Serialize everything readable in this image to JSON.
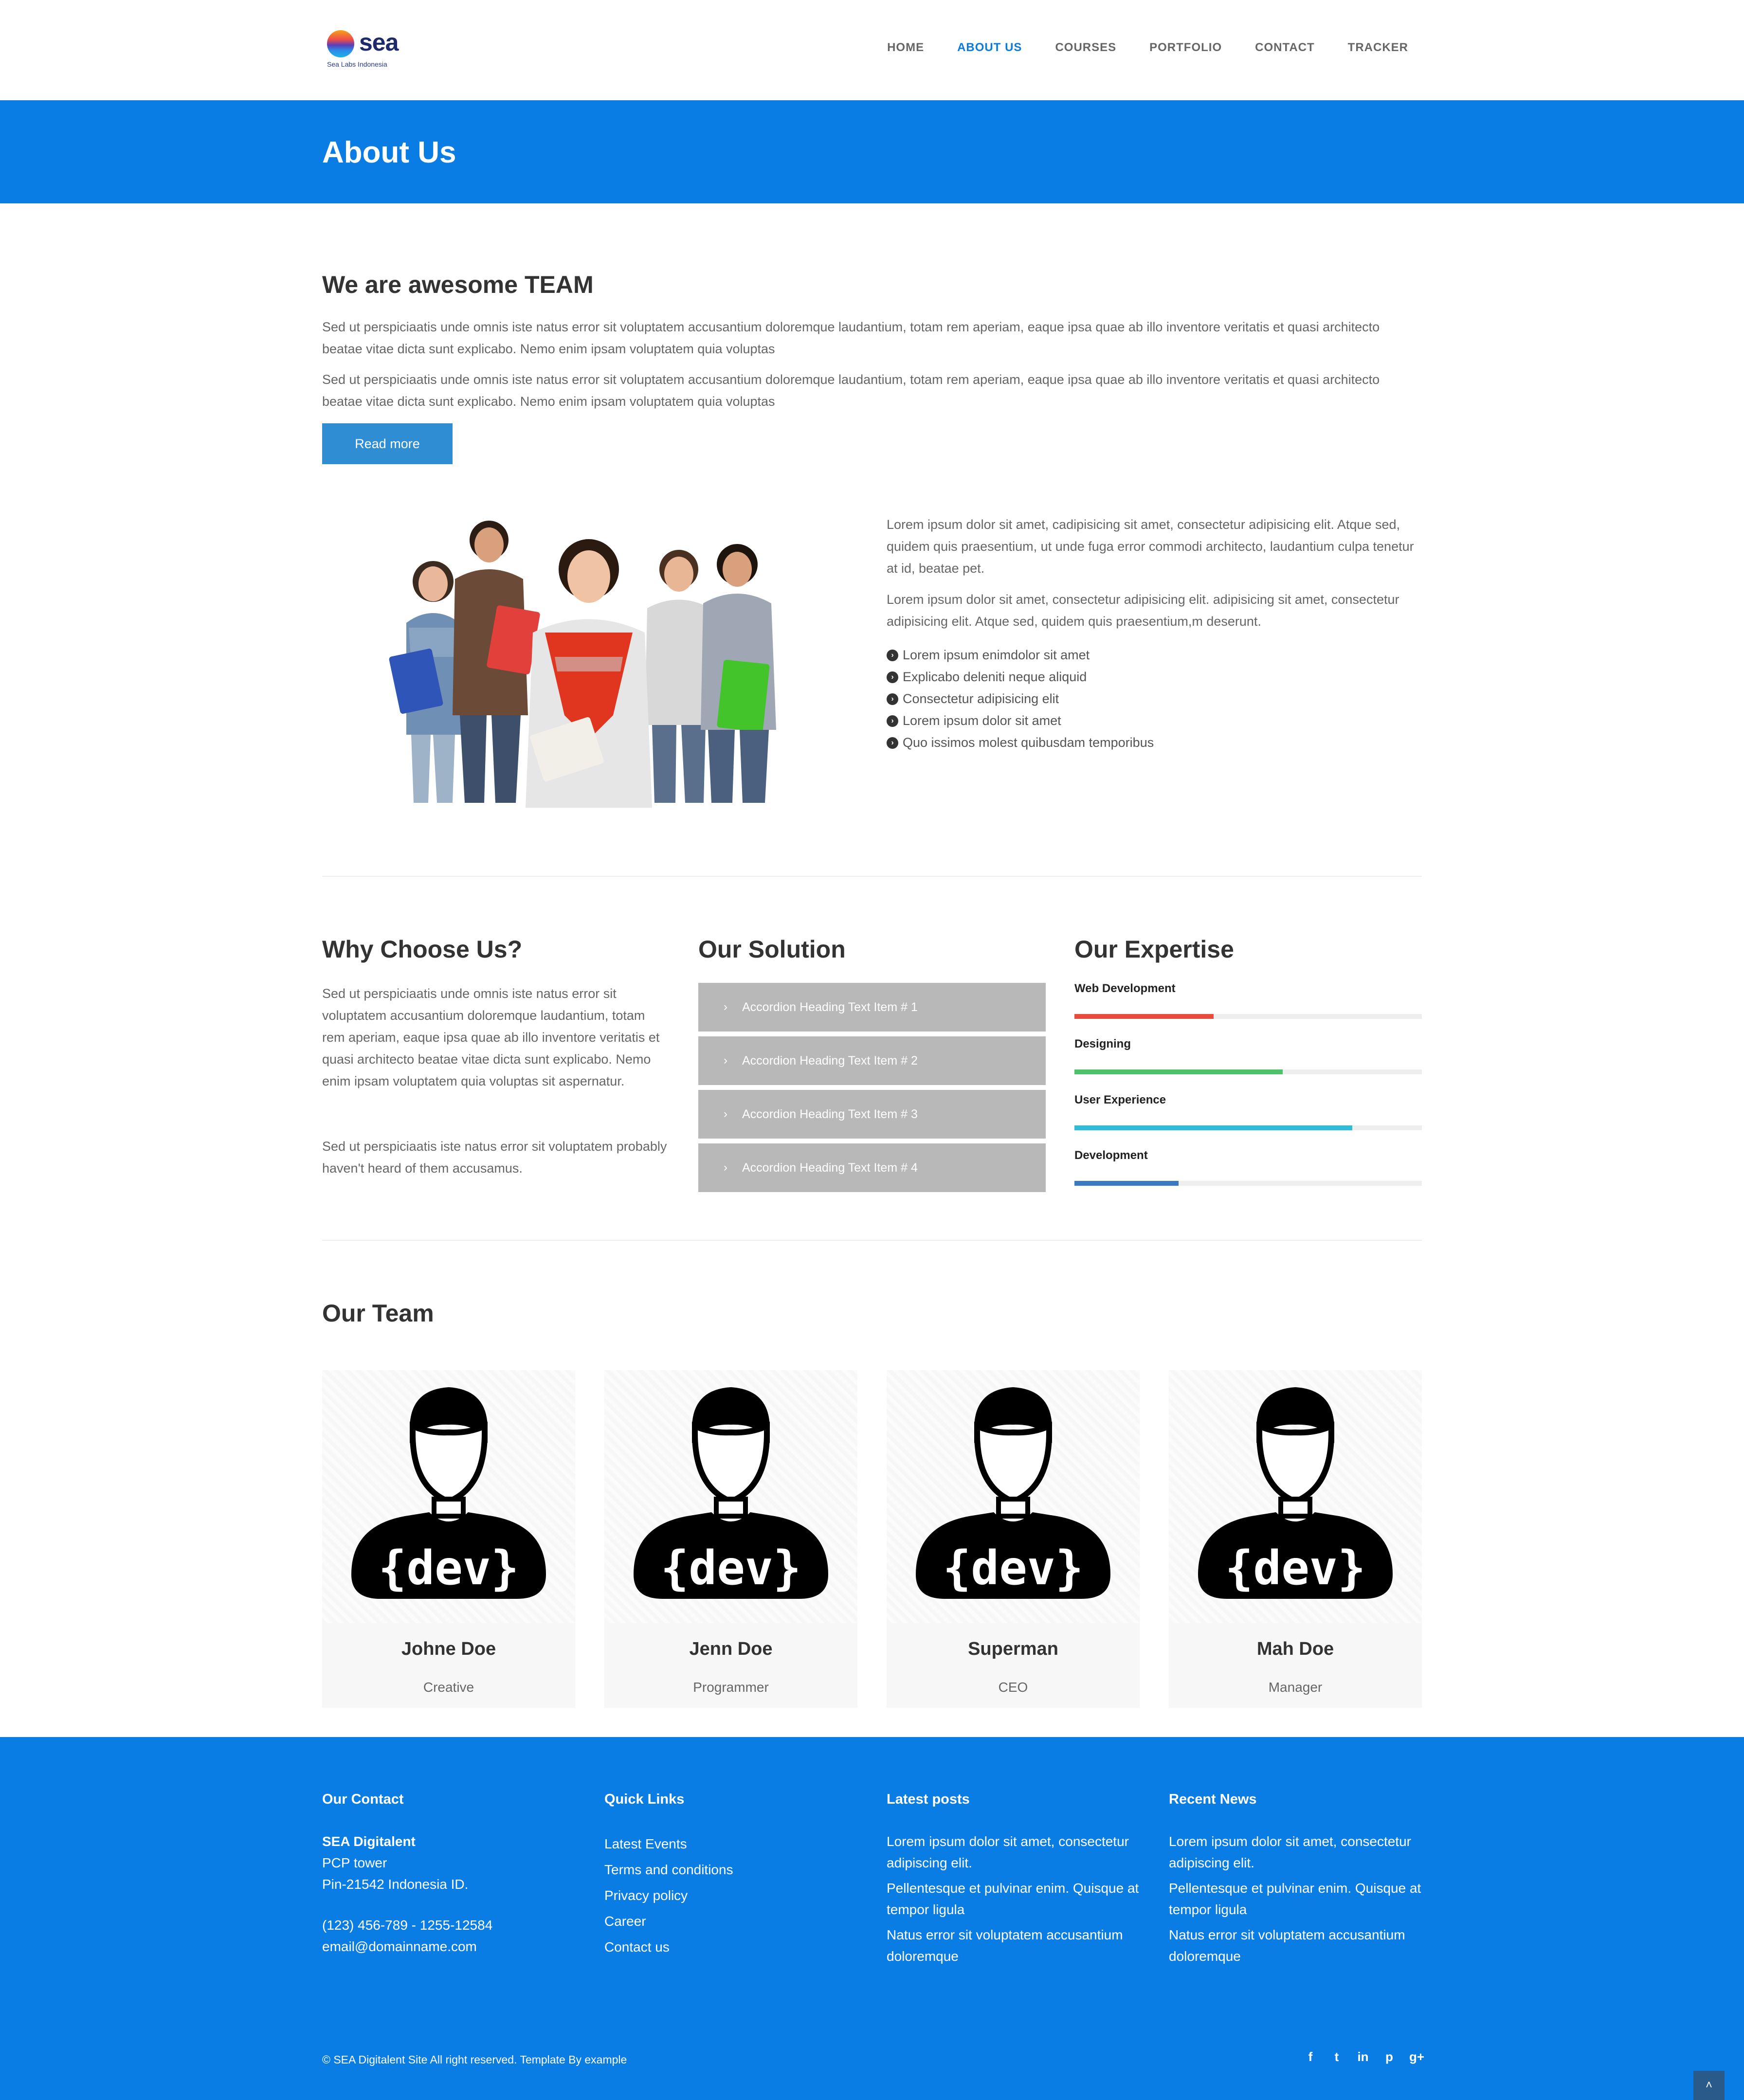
{
  "header": {
    "logo_text": "sea",
    "logo_sub": "Sea Labs Indonesia",
    "nav": [
      "HOME",
      "ABOUT US",
      "COURSES",
      "PORTFOLIO",
      "CONTACT",
      "TRACKER"
    ],
    "active_nav": "ABOUT US",
    "accent_color": "#0a7de5"
  },
  "banner": {
    "title": "About Us"
  },
  "intro": {
    "title": "We are awesome TEAM",
    "p1": "Sed ut perspiciaatis unde omnis iste natus error sit voluptatem accusantium doloremque laudantium, totam rem aperiam, eaque ipsa quae ab illo inventore veritatis et quasi architecto beatae vitae dicta sunt explicabo. Nemo enim ipsam voluptatem quia voluptas",
    "p2": "Sed ut perspiciaatis unde omnis iste natus error sit voluptatem accusantium doloremque laudantium, totam rem aperiam, eaque ipsa quae ab illo inventore veritatis et quasi architecto beatae vitae dicta sunt explicabo. Nemo enim ipsam voluptatem quia voluptas",
    "button": "Read more"
  },
  "about": {
    "p1": "Lorem ipsum dolor sit amet, cadipisicing sit amet, consectetur adipisicing elit. Atque sed, quidem quis praesentium, ut unde fuga error commodi architecto, laudantium culpa tenetur at id, beatae pet.",
    "p2": "Lorem ipsum dolor sit amet, consectetur adipisicing elit. adipisicing sit amet, consectetur adipisicing elit. Atque sed, quidem quis praesentium,m deserunt.",
    "list": [
      "Lorem ipsum enimdolor sit amet",
      "Explicabo deleniti neque aliquid",
      "Consectetur adipisicing elit",
      "Lorem ipsum dolor sit amet",
      "Quo issimos molest quibusdam temporibus"
    ]
  },
  "why": {
    "title": "Why Choose Us?",
    "p1": "Sed ut perspiciaatis unde omnis iste natus error sit voluptatem accusantium doloremque laudantium, totam rem aperiam, eaque ipsa quae ab illo inventore veritatis et quasi architecto beatae vitae dicta sunt explicabo. Nemo enim ipsam voluptatem quia voluptas sit aspernatur.",
    "p2": "Sed ut perspiciaatis iste natus error sit voluptatem probably haven't heard of them accusamus."
  },
  "solution": {
    "title": "Our Solution",
    "items": [
      "Accordion Heading Text Item # 1",
      "Accordion Heading Text Item # 2",
      "Accordion Heading Text Item # 3",
      "Accordion Heading Text Item # 4"
    ]
  },
  "expertise": {
    "title": "Our Expertise",
    "skills": [
      {
        "label": "Web Development",
        "level": 0.4,
        "color": "#e74c3c"
      },
      {
        "label": "Designing",
        "level": 0.6,
        "color": "#4cc36b"
      },
      {
        "label": "User Experience",
        "level": 0.8,
        "color": "#2fbcd8"
      },
      {
        "label": "Development",
        "level": 0.3,
        "color": "#3a78c4"
      }
    ]
  },
  "team": {
    "title": "Our Team",
    "badge_text": "{dev}",
    "members": [
      {
        "name": "Johne Doe",
        "role": "Creative"
      },
      {
        "name": "Jenn Doe",
        "role": "Programmer"
      },
      {
        "name": "Superman",
        "role": "CEO"
      },
      {
        "name": "Mah Doe",
        "role": "Manager"
      }
    ]
  },
  "footer": {
    "contact": {
      "title": "Our Contact",
      "company": "SEA Digitalent",
      "line1": "PCP tower",
      "line2": "Pin-21542 Indonesia ID.",
      "phone": "(123) 456-789 - 1255-12584",
      "email": "email@domainname.com"
    },
    "quick_links": {
      "title": "Quick Links",
      "items": [
        "Latest Events",
        "Terms and conditions",
        "Privacy policy",
        "Career",
        "Contact us"
      ]
    },
    "latest_posts": {
      "title": "Latest posts",
      "items": [
        "Lorem ipsum dolor sit amet, consectetur adipiscing elit.",
        "Pellentesque et pulvinar enim. Quisque at tempor ligula",
        "Natus error sit voluptatem accusantium doloremque"
      ]
    },
    "recent_news": {
      "title": "Recent News",
      "items": [
        "Lorem ipsum dolor sit amet, consectetur adipiscing elit.",
        "Pellentesque et pulvinar enim. Quisque at tempor ligula",
        "Natus error sit voluptatem accusantium doloremque"
      ]
    },
    "copyright": "© SEA Digitalent Site All right reserved. Template By example",
    "social": [
      "facebook-icon",
      "twitter-icon",
      "linkedin-icon",
      "pinterest-icon",
      "google-plus-icon"
    ],
    "social_glyphs": [
      "f",
      "t",
      "in",
      "p",
      "g+"
    ]
  }
}
